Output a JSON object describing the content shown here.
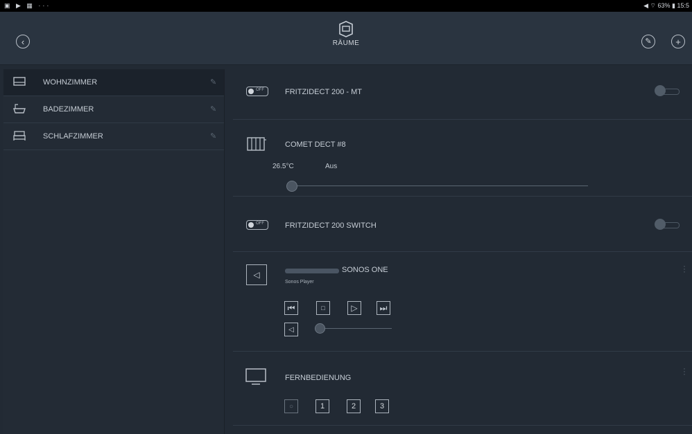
{
  "statusbar": {
    "right": "◀ ⌔ 63% ▮ 15:5"
  },
  "header": {
    "title": "RÄUME"
  },
  "sidebar": {
    "items": [
      {
        "label": "WOHNZIMMER"
      },
      {
        "label": "BADEZIMMER"
      },
      {
        "label": "SCHLAFZIMMER"
      }
    ]
  },
  "devices": {
    "fritz_mt": {
      "name": "FRITZIDECT 200 - MT",
      "toggle_text": "OFF"
    },
    "comet": {
      "name": "COMET DECT #8",
      "temperature": "26.5°C",
      "mode": "Aus",
      "slider_level": 0
    },
    "fritz_switch": {
      "name": "FRITZIDECT 200 SWITCH",
      "toggle_text": "OFF"
    },
    "sonos": {
      "name": "SONOS ONE",
      "subtitle": "Sonos Player",
      "volume_level": 0
    },
    "remote": {
      "name": "FERNBEDIENUNG",
      "buttons": [
        "1",
        "2",
        "3"
      ]
    }
  },
  "icons": {
    "back": "chevron-left-icon",
    "edit": "pencil-icon",
    "add": "plus-icon"
  },
  "colors": {
    "background": "#222a34",
    "topbar": "#2a3440",
    "text": "#c8ced6"
  }
}
